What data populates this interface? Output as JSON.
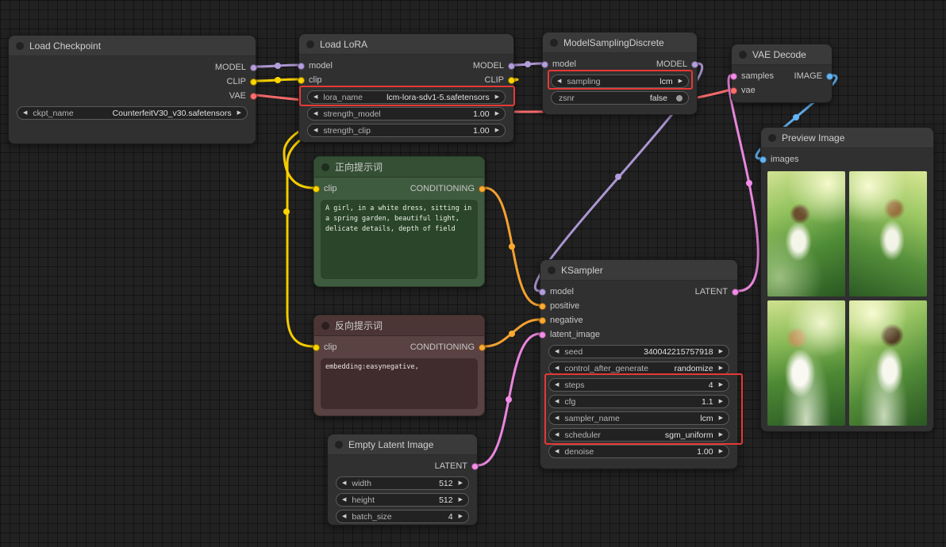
{
  "icons": {
    "arrow_left": "◀",
    "arrow_right": "▶"
  },
  "colors": {
    "model": "#B39DDB",
    "clip": "#FFD500",
    "vae": "#FF6E6E",
    "conditioning": "#FFA931",
    "latent": "#F48CE8",
    "image": "#64B5F6",
    "highlight": "#E53935"
  },
  "nodes": {
    "load_checkpoint": {
      "title": "Load Checkpoint",
      "outputs": {
        "model": "MODEL",
        "clip": "CLIP",
        "vae": "VAE"
      },
      "widgets": {
        "ckpt_name": {
          "label": "ckpt_name",
          "value": "CounterfeitV30_v30.safetensors"
        }
      }
    },
    "load_lora": {
      "title": "Load LoRA",
      "inputs": {
        "model": "model",
        "clip": "clip"
      },
      "outputs": {
        "model": "MODEL",
        "clip": "CLIP"
      },
      "widgets": {
        "lora_name": {
          "label": "lora_name",
          "value": "lcm-lora-sdv1-5.safetensors"
        },
        "strength_model": {
          "label": "strength_model",
          "value": "1.00"
        },
        "strength_clip": {
          "label": "strength_clip",
          "value": "1.00"
        }
      }
    },
    "model_sampling": {
      "title": "ModelSamplingDiscrete",
      "inputs": {
        "model": "model"
      },
      "outputs": {
        "model": "MODEL"
      },
      "widgets": {
        "sampling": {
          "label": "sampling",
          "value": "lcm"
        },
        "zsnr": {
          "label": "zsnr",
          "value": "false"
        }
      }
    },
    "vae_decode": {
      "title": "VAE Decode",
      "inputs": {
        "samples": "samples",
        "vae": "vae"
      },
      "outputs": {
        "image": "IMAGE"
      }
    },
    "preview_image": {
      "title": "Preview Image",
      "inputs": {
        "images": "images"
      }
    },
    "positive_prompt": {
      "title": "正向提示词",
      "inputs": {
        "clip": "clip"
      },
      "outputs": {
        "conditioning": "CONDITIONING"
      },
      "text": "A girl, in a white dress, sitting in a spring garden, beautiful light, delicate details, depth of field"
    },
    "negative_prompt": {
      "title": "反向提示词",
      "inputs": {
        "clip": "clip"
      },
      "outputs": {
        "conditioning": "CONDITIONING"
      },
      "text": "embedding:easynegative,"
    },
    "empty_latent": {
      "title": "Empty Latent Image",
      "outputs": {
        "latent": "LATENT"
      },
      "widgets": {
        "width": {
          "label": "width",
          "value": "512"
        },
        "height": {
          "label": "height",
          "value": "512"
        },
        "batch_size": {
          "label": "batch_size",
          "value": "4"
        }
      }
    },
    "ksampler": {
      "title": "KSampler",
      "inputs": {
        "model": "model",
        "positive": "positive",
        "negative": "negative",
        "latent_image": "latent_image"
      },
      "outputs": {
        "latent": "LATENT"
      },
      "widgets": {
        "seed": {
          "label": "seed",
          "value": "340042215757918"
        },
        "control_after_generate": {
          "label": "control_after_generate",
          "value": "randomize"
        },
        "steps": {
          "label": "steps",
          "value": "4"
        },
        "cfg": {
          "label": "cfg",
          "value": "1.1"
        },
        "sampler_name": {
          "label": "sampler_name",
          "value": "lcm"
        },
        "scheduler": {
          "label": "scheduler",
          "value": "sgm_uniform"
        },
        "denoise": {
          "label": "denoise",
          "value": "1.00"
        }
      }
    }
  }
}
